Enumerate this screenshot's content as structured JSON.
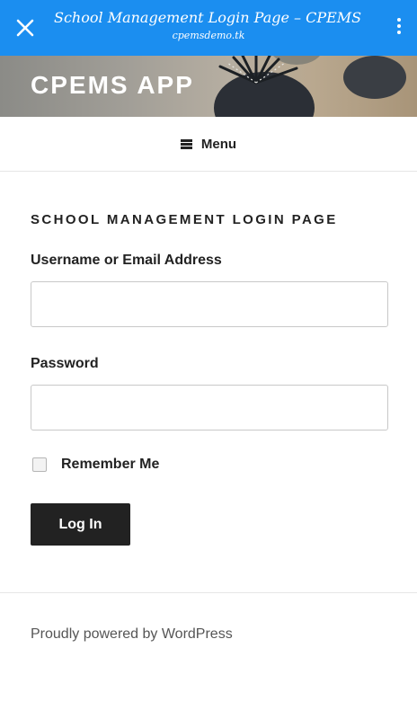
{
  "browser": {
    "page_title": "School Management Login Page – CPEMS APP",
    "url": "cpemsdemo.tk",
    "close_icon": "close-icon",
    "menu_icon": "more-vertical-icon"
  },
  "site": {
    "title": "CPEMS APP"
  },
  "nav": {
    "menu_label": "Menu",
    "menu_icon": "hamburger-icon"
  },
  "login": {
    "heading": "SCHOOL MANAGEMENT LOGIN PAGE",
    "username_label": "Username or Email Address",
    "username_value": "",
    "password_label": "Password",
    "password_value": "",
    "remember_label": "Remember Me",
    "remember_checked": false,
    "submit_label": "Log In"
  },
  "footer": {
    "text": "Proudly powered by WordPress"
  },
  "colors": {
    "browser_bar": "#1b8ef0",
    "button_bg": "#222222",
    "text": "#222222"
  }
}
